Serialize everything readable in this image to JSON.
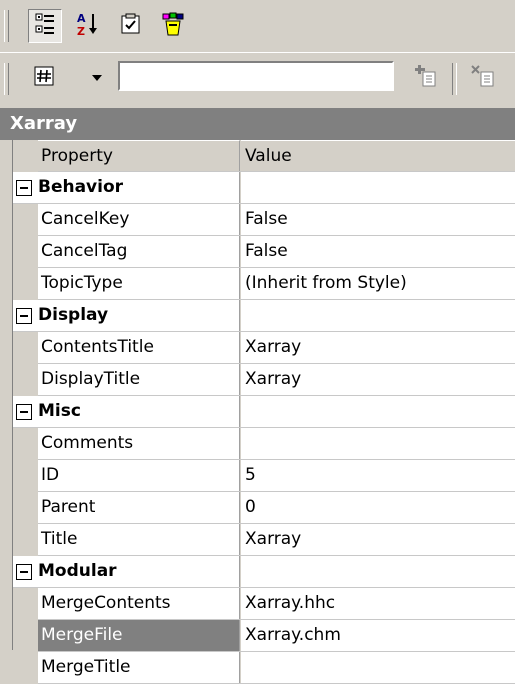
{
  "object_name": "Xarray",
  "toolbar": {
    "categorized_icon": "categorized-icon",
    "alphabetical_icon": "alphabetical-icon",
    "property_pages_icon": "property-pages-icon",
    "events_icon": "events-icon",
    "topic_icon": "topic-id-icon",
    "search_value": "",
    "add_icon": "add-item-icon",
    "remove_icon": "remove-item-icon"
  },
  "grid": {
    "header": {
      "property": "Property",
      "value": "Value"
    },
    "rows": [
      {
        "type": "category",
        "label": "Behavior"
      },
      {
        "type": "prop",
        "name": "CancelKey",
        "value": "False"
      },
      {
        "type": "prop",
        "name": "CancelTag",
        "value": "False"
      },
      {
        "type": "prop",
        "name": "TopicType",
        "value": "(Inherit from Style)"
      },
      {
        "type": "category",
        "label": "Display"
      },
      {
        "type": "prop",
        "name": "ContentsTitle",
        "value": "Xarray"
      },
      {
        "type": "prop",
        "name": "DisplayTitle",
        "value": "Xarray"
      },
      {
        "type": "category",
        "label": "Misc"
      },
      {
        "type": "prop",
        "name": "Comments",
        "value": ""
      },
      {
        "type": "prop",
        "name": "ID",
        "value": "5"
      },
      {
        "type": "prop",
        "name": "Parent",
        "value": "0"
      },
      {
        "type": "prop",
        "name": "Title",
        "value": "Xarray"
      },
      {
        "type": "category",
        "label": "Modular"
      },
      {
        "type": "prop",
        "name": "MergeContents",
        "value": "Xarray.hhc"
      },
      {
        "type": "prop",
        "name": "MergeFile",
        "value": "Xarray.chm",
        "selected": true
      },
      {
        "type": "prop",
        "name": "MergeTitle",
        "value": ""
      }
    ]
  },
  "colors": {
    "face": "#d4d0c8",
    "shadow": "#808080",
    "selection": "#808080"
  }
}
